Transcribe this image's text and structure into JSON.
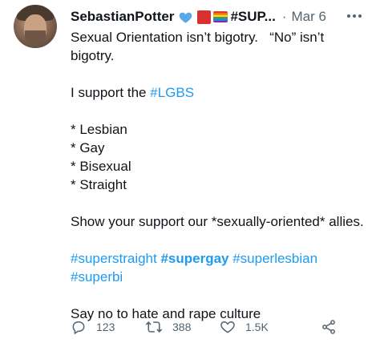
{
  "tweet": {
    "display_name": "SebastianPotter",
    "name_suffix": "#SUP...",
    "separator": "·",
    "date": "Mar 6",
    "body_lines": [
      [
        "Sexual Orientation isn’t bigotry.   “No” isn’t"
      ],
      [
        "bigotry."
      ],
      [],
      [
        "I support the ",
        {
          "link": "#LGBS"
        }
      ],
      [],
      [
        "* Lesbian"
      ],
      [
        "* Gay"
      ],
      [
        "* Bisexual"
      ],
      [
        "* Straight"
      ],
      [],
      [
        "Show your support our *sexually-oriented* allies."
      ],
      [],
      [
        {
          "link": "#superstraight "
        },
        {
          "link_bold": "#supergay"
        },
        {
          "link": " #superlesbian"
        }
      ],
      [
        {
          "link": "#superbi"
        }
      ],
      [],
      [
        "Say no to hate and rape culture"
      ]
    ]
  },
  "actions": {
    "reply_count": "123",
    "retweet_count": "388",
    "like_count": "1.5K"
  },
  "colors": {
    "link": "#1d9bf0",
    "muted": "#536471",
    "verified": "#1d9bf0"
  },
  "icons": [
    "blue-heart-icon",
    "red-square-icon",
    "rainbow-flag-icon",
    "more-icon",
    "reply-icon",
    "retweet-icon",
    "like-icon",
    "share-icon"
  ]
}
